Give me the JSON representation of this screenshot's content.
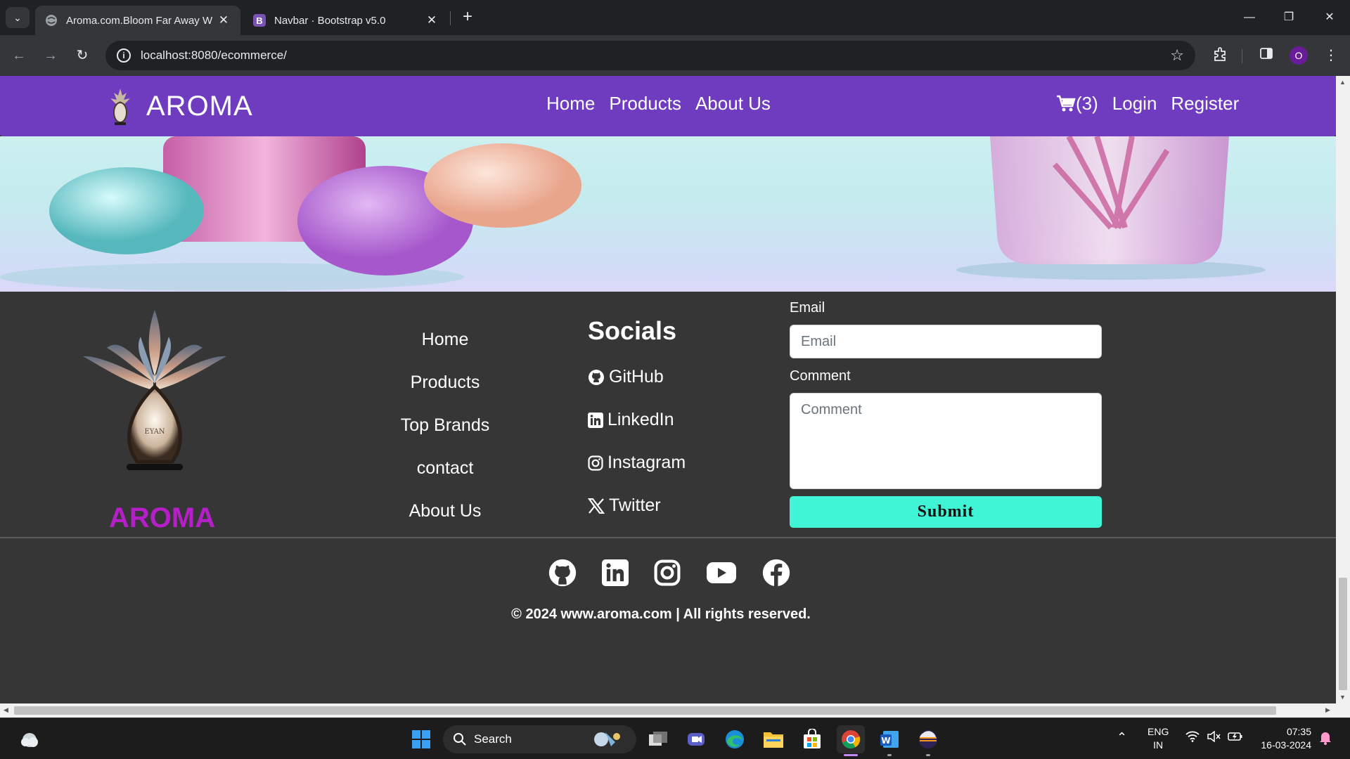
{
  "browser": {
    "tabs": [
      {
        "title": "Aroma.com.Bloom Far Away W",
        "active": true
      },
      {
        "title": "Navbar · Bootstrap v5.0",
        "active": false
      }
    ],
    "url": "localhost:8080/ecommerce/",
    "profile_initial": "O"
  },
  "navbar": {
    "brand": "AROMA",
    "links": [
      "Home",
      "Products",
      "About Us"
    ],
    "cart_count": "(3)",
    "login": "Login",
    "register": "Register",
    "bg_color": "#6f3cc0"
  },
  "footer": {
    "brand": "AROMA",
    "brand_color": "#b61ec9",
    "links": [
      "Home",
      "Products",
      "Top Brands",
      "contact",
      "About Us"
    ],
    "socials_title": "Socials",
    "socials": [
      {
        "label": "GitHub",
        "icon": "github-icon"
      },
      {
        "label": "LinkedIn",
        "icon": "linkedin-icon"
      },
      {
        "label": "Instagram",
        "icon": "instagram-icon"
      },
      {
        "label": "Twitter",
        "icon": "x-twitter-icon"
      }
    ],
    "form": {
      "email_label": "Email",
      "email_placeholder": "Email",
      "comment_label": "Comment",
      "comment_placeholder": "Comment",
      "submit": "Submit",
      "submit_color": "#40f5d5"
    },
    "bottom_icons": [
      "github-icon",
      "linkedin-icon",
      "instagram-icon",
      "youtube-icon",
      "facebook-icon"
    ],
    "copyright": "© 2024 www.aroma.com | All rights reserved."
  },
  "taskbar": {
    "search_placeholder": "Search",
    "language": "ENG",
    "region": "IN",
    "time": "07:35",
    "date": "16-03-2024"
  }
}
